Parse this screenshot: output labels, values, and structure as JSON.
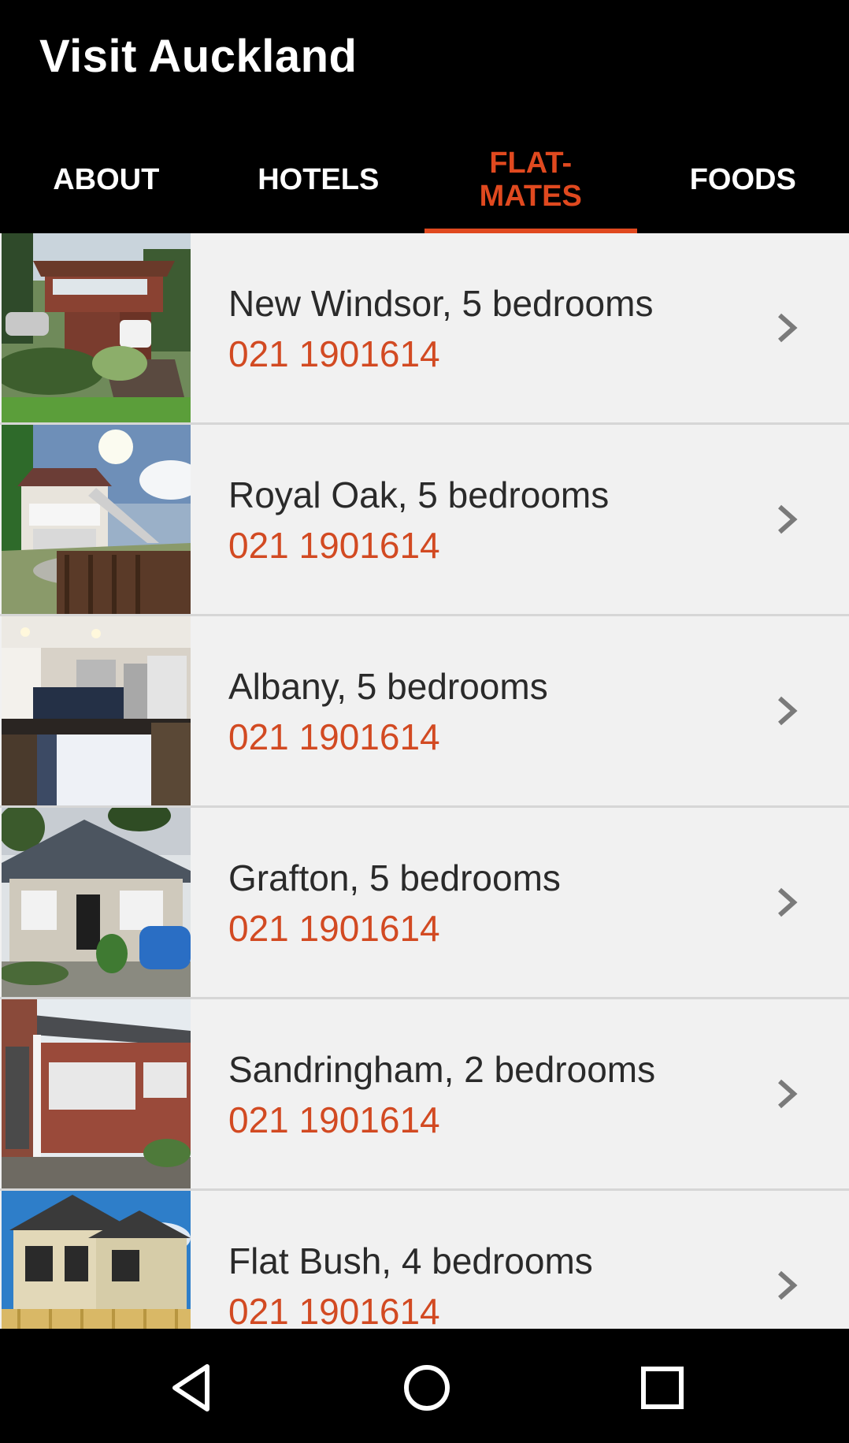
{
  "app": {
    "title": "Visit Auckland",
    "accent_color": "#e0491f"
  },
  "tabs": [
    {
      "label": "ABOUT",
      "active": false
    },
    {
      "label": "HOTELS",
      "active": false
    },
    {
      "label": "FLAT-\nMATES",
      "active": true
    },
    {
      "label": "FOODS",
      "active": false
    }
  ],
  "listings": [
    {
      "name": "New Windsor, 5 bedrooms",
      "phone": "021 1901614",
      "icon": "chevron-right-icon"
    },
    {
      "name": "Royal Oak, 5 bedrooms",
      "phone": "021 1901614",
      "icon": "chevron-right-icon"
    },
    {
      "name": "Albany, 5 bedrooms",
      "phone": "021 1901614",
      "icon": "chevron-right-icon"
    },
    {
      "name": "Grafton, 5 bedrooms",
      "phone": "021 1901614",
      "icon": "chevron-right-icon"
    },
    {
      "name": "Sandringham, 2 bedrooms",
      "phone": "021 1901614",
      "icon": "chevron-right-icon"
    },
    {
      "name": "Flat Bush, 4 bedrooms",
      "phone": "021 1901614",
      "icon": "chevron-right-icon"
    }
  ],
  "system_nav": {
    "buttons": [
      "back-icon",
      "home-icon",
      "recents-icon"
    ]
  }
}
